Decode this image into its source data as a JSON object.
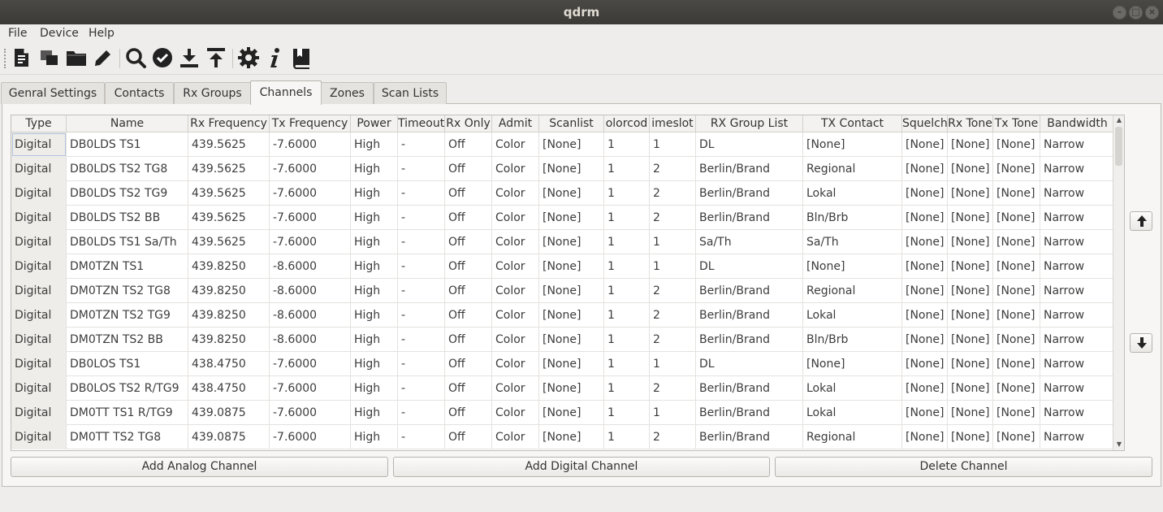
{
  "window": {
    "title": "qdrm"
  },
  "menu": [
    "File",
    "Device",
    "Help"
  ],
  "toolbar": [
    {
      "icon": "new-document-icon"
    },
    {
      "icon": "copy-window-icon"
    },
    {
      "icon": "open-folder-icon"
    },
    {
      "icon": "edit-pencil-icon"
    },
    {
      "icon": "search-icon"
    },
    {
      "icon": "verify-check-icon"
    },
    {
      "icon": "download-icon"
    },
    {
      "icon": "upload-icon"
    },
    {
      "icon": "settings-gear-icon"
    },
    {
      "icon": "info-icon"
    },
    {
      "icon": "book-icon"
    }
  ],
  "tabs": [
    "Genral Settings",
    "Contacts",
    "Rx Groups",
    "Channels",
    "Zones",
    "Scan Lists"
  ],
  "active_tab": "Channels",
  "table": {
    "columns": [
      "Type",
      "Name",
      "Rx Frequency",
      "Tx Frequency",
      "Power",
      "Timeout",
      "Rx Only",
      "Admit",
      "Scanlist",
      "olorcod",
      "imeslot",
      "RX Group List",
      "TX Contact",
      "Squelch",
      "Rx Tone",
      "Tx Tone",
      "Bandwidth"
    ],
    "rows": [
      [
        "Digital",
        "DB0LDS TS1",
        "439.5625",
        "-7.6000",
        "High",
        "-",
        "Off",
        "Color",
        "[None]",
        "1",
        "1",
        "DL",
        "[None]",
        "[None]",
        "[None]",
        "[None]",
        "Narrow"
      ],
      [
        "Digital",
        "DB0LDS TS2 TG8",
        "439.5625",
        "-7.6000",
        "High",
        "-",
        "Off",
        "Color",
        "[None]",
        "1",
        "2",
        "Berlin/Brand",
        "Regional",
        "[None]",
        "[None]",
        "[None]",
        "Narrow"
      ],
      [
        "Digital",
        "DB0LDS TS2 TG9",
        "439.5625",
        "-7.6000",
        "High",
        "-",
        "Off",
        "Color",
        "[None]",
        "1",
        "2",
        "Berlin/Brand",
        "Lokal",
        "[None]",
        "[None]",
        "[None]",
        "Narrow"
      ],
      [
        "Digital",
        "DB0LDS TS2 BB",
        "439.5625",
        "-7.6000",
        "High",
        "-",
        "Off",
        "Color",
        "[None]",
        "1",
        "2",
        "Berlin/Brand",
        "Bln/Brb",
        "[None]",
        "[None]",
        "[None]",
        "Narrow"
      ],
      [
        "Digital",
        "DB0LDS TS1 Sa/Th",
        "439.5625",
        "-7.6000",
        "High",
        "-",
        "Off",
        "Color",
        "[None]",
        "1",
        "1",
        "Sa/Th",
        "Sa/Th",
        "[None]",
        "[None]",
        "[None]",
        "Narrow"
      ],
      [
        "Digital",
        "DM0TZN TS1",
        "439.8250",
        "-8.6000",
        "High",
        "-",
        "Off",
        "Color",
        "[None]",
        "1",
        "1",
        "DL",
        "[None]",
        "[None]",
        "[None]",
        "[None]",
        "Narrow"
      ],
      [
        "Digital",
        "DM0TZN TS2 TG8",
        "439.8250",
        "-8.6000",
        "High",
        "-",
        "Off",
        "Color",
        "[None]",
        "1",
        "2",
        "Berlin/Brand",
        "Regional",
        "[None]",
        "[None]",
        "[None]",
        "Narrow"
      ],
      [
        "Digital",
        "DM0TZN TS2 TG9",
        "439.8250",
        "-8.6000",
        "High",
        "-",
        "Off",
        "Color",
        "[None]",
        "1",
        "2",
        "Berlin/Brand",
        "Lokal",
        "[None]",
        "[None]",
        "[None]",
        "Narrow"
      ],
      [
        "Digital",
        "DM0TZN TS2 BB",
        "439.8250",
        "-8.6000",
        "High",
        "-",
        "Off",
        "Color",
        "[None]",
        "1",
        "2",
        "Berlin/Brand",
        "Bln/Brb",
        "[None]",
        "[None]",
        "[None]",
        "Narrow"
      ],
      [
        "Digital",
        "DB0LOS TS1",
        "438.4750",
        "-7.6000",
        "High",
        "-",
        "Off",
        "Color",
        "[None]",
        "1",
        "1",
        "DL",
        "[None]",
        "[None]",
        "[None]",
        "[None]",
        "Narrow"
      ],
      [
        "Digital",
        "DB0LOS TS2 R/TG9",
        "438.4750",
        "-7.6000",
        "High",
        "-",
        "Off",
        "Color",
        "[None]",
        "1",
        "2",
        "Berlin/Brand",
        "Lokal",
        "[None]",
        "[None]",
        "[None]",
        "Narrow"
      ],
      [
        "Digital",
        "DM0TT TS1 R/TG9",
        "439.0875",
        "-7.6000",
        "High",
        "-",
        "Off",
        "Color",
        "[None]",
        "1",
        "1",
        "Berlin/Brand",
        "Lokal",
        "[None]",
        "[None]",
        "[None]",
        "Narrow"
      ],
      [
        "Digital",
        "DM0TT TS2 TG8",
        "439.0875",
        "-7.6000",
        "High",
        "-",
        "Off",
        "Color",
        "[None]",
        "1",
        "2",
        "Berlin/Brand",
        "Regional",
        "[None]",
        "[None]",
        "[None]",
        "Narrow"
      ]
    ]
  },
  "side_buttons": [
    {
      "icon": "move-up-arrow-icon"
    },
    {
      "icon": "move-down-arrow-icon"
    }
  ],
  "buttons": {
    "add_analog": "Add Analog Channel",
    "add_digital": "Add Digital Channel",
    "delete": "Delete Channel"
  }
}
